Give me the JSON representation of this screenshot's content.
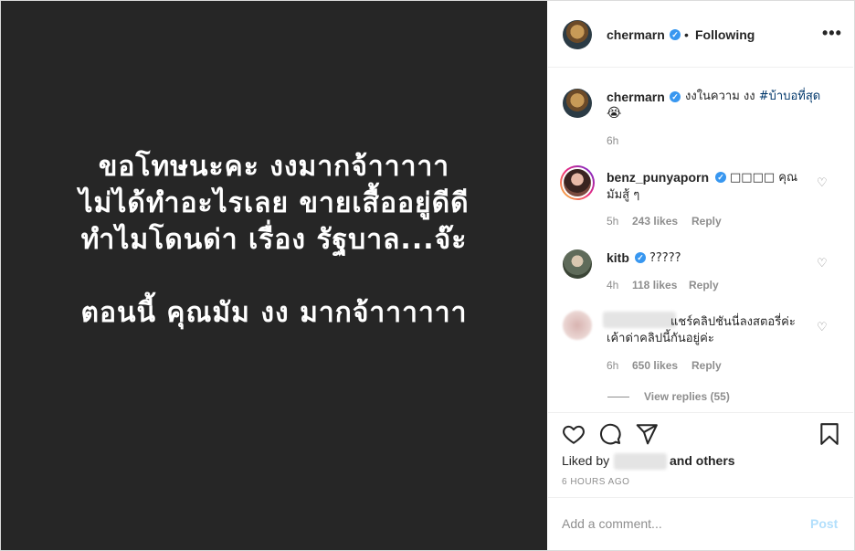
{
  "media": {
    "lines": [
      "ขอโทษนะคะ งงมากจ้าาาาา",
      "ไม่ได้ทำอะไรเลย ขายเสื้ออยู่ดีดี",
      "ทำไมโดนด่า เรื่อง รัฐบาล...จ๊ะ",
      "ตอนนี้ คุณมัม งง มากจ้าาาาาา"
    ]
  },
  "header": {
    "username": "chermarn",
    "verified_mark": "✓",
    "dot": "•",
    "following": "Following",
    "more": "•••"
  },
  "caption": {
    "username": "chermarn",
    "text": "งงในความ งง ",
    "hashtag": "#บ้าบอที่สุด",
    "emoji": "😭",
    "time": "6h"
  },
  "comments": [
    {
      "username": "benz_punyaporn",
      "text_line1": "□□□□ คุณ",
      "text_line2": "มัมสู้ ๆ",
      "time": "5h",
      "likes": "243 likes",
      "reply": "Reply"
    },
    {
      "username": "kitb",
      "text_line1": "?????",
      "time": "4h",
      "likes": "118 likes",
      "reply": "Reply"
    },
    {
      "username": "",
      "text_line1": "แชร์คลิปชันนี่ลงสตอรี่ค่ะ",
      "text_line2": "เค้าด่าคลิปนี้กันอยู่ค่ะ",
      "time": "6h",
      "likes": "650 likes",
      "reply": "Reply"
    }
  ],
  "view_replies": "View replies (55)",
  "actions": {
    "liked_by": "Liked by",
    "and_others": "and others",
    "time_ago": "6 HOURS AGO"
  },
  "comment_box": {
    "placeholder": "Add a comment...",
    "post": "Post"
  },
  "colors": {
    "media_bg": "#262626",
    "verified": "#3897f0",
    "hashtag": "#00376b",
    "post_disabled": "#b2dffc"
  },
  "icons": [
    "heart-icon",
    "comment-icon",
    "share-icon",
    "bookmark-icon",
    "verified-icon",
    "more-icon"
  ]
}
